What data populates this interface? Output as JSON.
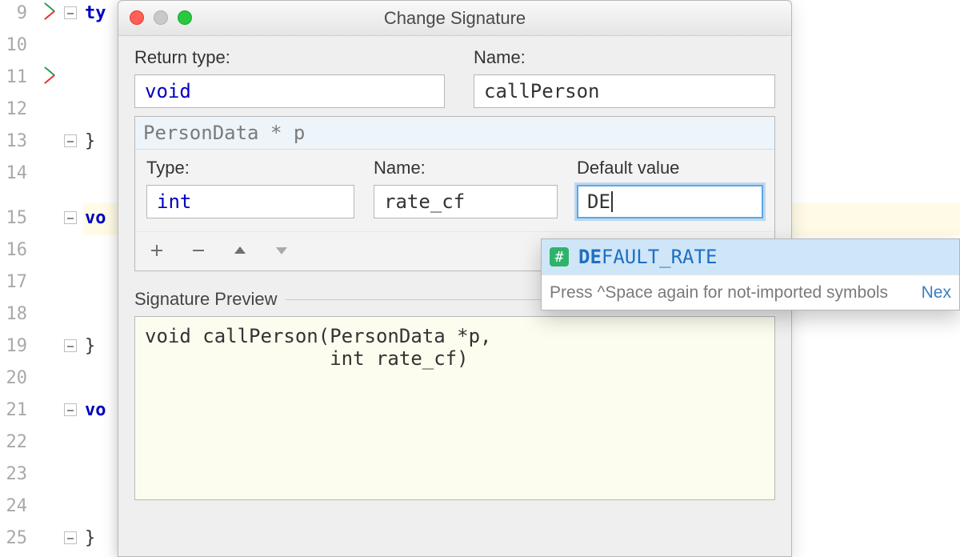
{
  "editor": {
    "line_numbers": [
      "9",
      "10",
      "11",
      "12",
      "13",
      "14",
      "15",
      "16",
      "17",
      "18",
      "19",
      "20",
      "21",
      "22",
      "23",
      "24",
      "25"
    ],
    "fragments": {
      "ty": "ty",
      "brace": "}",
      "vo": "vo"
    }
  },
  "dialog": {
    "title": "Change Signature",
    "return_type_label": "Return type:",
    "return_type_value": "void",
    "name_label": "Name:",
    "name_value": "callPerson",
    "param_list_signature": "PersonData * p",
    "param": {
      "type_label": "Type:",
      "type_value": "int",
      "name_label": "Name:",
      "name_value": "rate_cf",
      "default_label": "Default value",
      "default_value": "DE"
    },
    "preview_label": "Signature Preview",
    "preview_code": "void callPerson(PersonData *p,\n                int rate_cf)"
  },
  "autocomplete": {
    "icon_char": "#",
    "match_prefix": "DE",
    "rest": "FAULT_RATE",
    "footer_text": "Press ^Space again for not-imported symbols",
    "footer_link": "Nex"
  }
}
